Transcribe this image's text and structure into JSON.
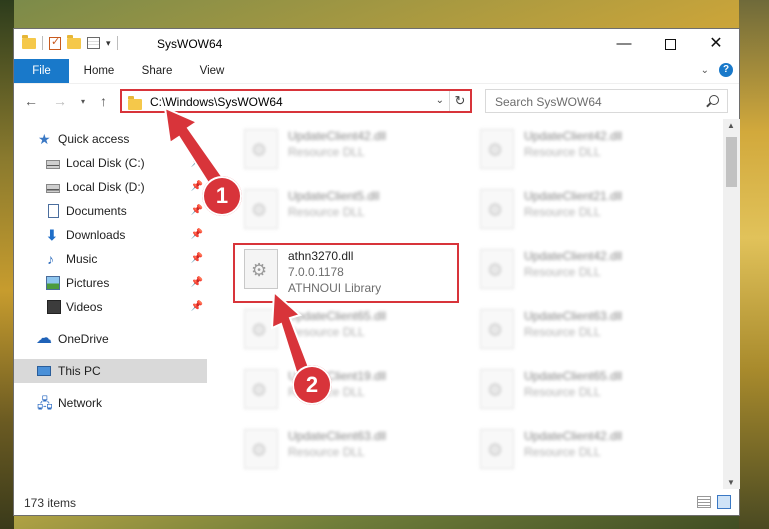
{
  "window": {
    "title": "SysWOW64",
    "minimize_glyph": "—",
    "close_glyph": "✕"
  },
  "ribbon": {
    "tabs": [
      "File",
      "Home",
      "Share",
      "View"
    ],
    "help_glyph": "?"
  },
  "address_bar": {
    "path": "C:\\Windows\\SysWOW64",
    "dropdown_glyph": "⌄",
    "refresh_glyph": "↻"
  },
  "search": {
    "placeholder": "Search SysWOW64"
  },
  "nav": {
    "back_glyph": "←",
    "forward_glyph": "→",
    "recent_glyph": "▾",
    "up_glyph": "↑"
  },
  "sidebar": {
    "items": [
      {
        "label": "Quick access",
        "icon": "star-icon"
      },
      {
        "label": "Local Disk (C:)",
        "icon": "disk-icon",
        "pinned": true
      },
      {
        "label": "Local Disk (D:)",
        "icon": "disk-icon",
        "pinned": true
      },
      {
        "label": "Documents",
        "icon": "documents-icon",
        "pinned": true
      },
      {
        "label": "Downloads",
        "icon": "downloads-icon",
        "pinned": true
      },
      {
        "label": "Music",
        "icon": "music-icon",
        "pinned": true
      },
      {
        "label": "Pictures",
        "icon": "pictures-icon",
        "pinned": true
      },
      {
        "label": "Videos",
        "icon": "videos-icon",
        "pinned": true
      },
      {
        "label": "OneDrive",
        "icon": "onedrive-icon"
      },
      {
        "label": "This PC",
        "icon": "computer-icon",
        "selected": true
      },
      {
        "label": "Network",
        "icon": "network-icon"
      }
    ]
  },
  "files": {
    "left": [
      {
        "name": "UpdateClient42.dll",
        "type": "Resource DLL"
      },
      {
        "name": "UpdateClient5.dll",
        "type": "Resource DLL"
      },
      {
        "name": "athn3270.dll",
        "version": "7.0.0.1178",
        "type": "ATHNOUI Library"
      },
      {
        "name": "UpdateClient65.dll",
        "type": "Resource DLL"
      },
      {
        "name": "UpdateClient19.dll",
        "type": "Resource DLL"
      },
      {
        "name": "UpdateClient63.dll",
        "type": "Resource DLL"
      }
    ],
    "right": [
      {
        "name": "UpdateClient42.dll",
        "type": "Resource DLL"
      },
      {
        "name": "UpdateClient21.dll",
        "type": "Resource DLL"
      },
      {
        "name": "UpdateClient42.dll",
        "type": "Resource DLL"
      },
      {
        "name": "UpdateClient63.dll",
        "type": "Resource DLL"
      },
      {
        "name": "UpdateClient65.dll",
        "type": "Resource DLL"
      },
      {
        "name": "UpdateClient42.dll",
        "type": "Resource DLL"
      }
    ]
  },
  "status": {
    "item_count": "173 items"
  },
  "annotations": {
    "step1": "1",
    "step2": "2",
    "color": "#d8343a"
  },
  "colors": {
    "accent": "#1979ca",
    "highlight": "#d8343a"
  }
}
